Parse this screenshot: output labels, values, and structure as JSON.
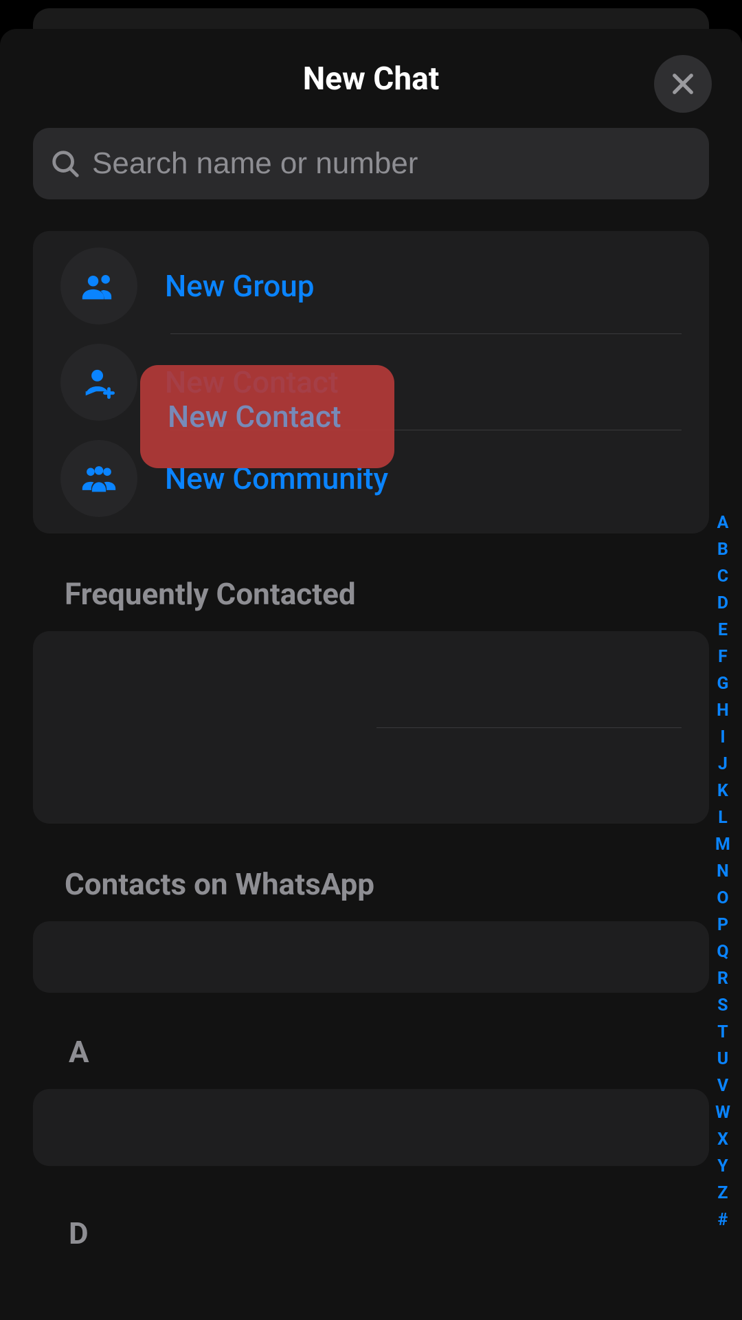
{
  "header": {
    "title": "New Chat"
  },
  "search": {
    "placeholder": "Search name or number"
  },
  "actions": {
    "new_group": "New Group",
    "new_contact": "New Contact",
    "new_community": "New Community"
  },
  "sections": {
    "frequently": "Frequently Contacted",
    "contacts_on": "Contacts on WhatsApp",
    "letter_a": "A",
    "letter_d": "D"
  },
  "index_letters": [
    "A",
    "B",
    "C",
    "D",
    "E",
    "F",
    "G",
    "H",
    "I",
    "J",
    "K",
    "L",
    "M",
    "N",
    "O",
    "P",
    "Q",
    "R",
    "S",
    "T",
    "U",
    "V",
    "W",
    "X",
    "Y",
    "Z",
    "#"
  ],
  "colors": {
    "accent": "#0a84ff",
    "highlight": "#b33a38"
  }
}
